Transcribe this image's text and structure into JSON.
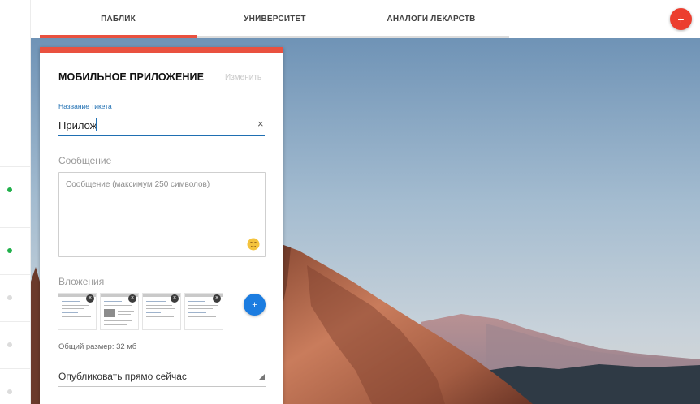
{
  "tabs": [
    {
      "label": "ПАБЛИК",
      "active": true
    },
    {
      "label": "УНИВЕРСИТЕТ",
      "active": false
    },
    {
      "label": "АНАЛОГИ ЛЕКАРСТВ",
      "active": false
    }
  ],
  "header": {
    "add_icon": "plus-icon",
    "add_label": "+"
  },
  "rail": {
    "rows": [
      {
        "status": "online"
      },
      {
        "status": "online"
      },
      {
        "status": "offline"
      },
      {
        "status": "offline"
      },
      {
        "status": "offline"
      }
    ]
  },
  "card": {
    "title": "МОБИЛЬНОЕ ПРИЛОЖЕНИЕ",
    "edit_label": "Изменить",
    "ticket_label": "Название тикета",
    "ticket_value": "Прилож",
    "clear_glyph": "×",
    "message_label": "Сообщение",
    "message_placeholder": "Сообщение (максимум 250 символов)",
    "attachments_label": "Вложения",
    "attachments": [
      {
        "remove_glyph": "×"
      },
      {
        "remove_glyph": "×"
      },
      {
        "remove_glyph": "×"
      },
      {
        "remove_glyph": "×"
      }
    ],
    "add_attachment_label": "+",
    "total_size": "Общий размер: 32 мб",
    "publish_value": "Опубликовать прямо сейчас"
  },
  "colors": {
    "accent_red": "#e9513f",
    "fab_red": "#ec3e2f",
    "fab_blue": "#1b7ce0",
    "focus_blue": "#1f6fb2",
    "online_green": "#21b04b"
  },
  "icons": [
    "plus-icon",
    "close-icon",
    "emoji-icon",
    "dropdown-arrow-icon",
    "status-dot-icon"
  ]
}
